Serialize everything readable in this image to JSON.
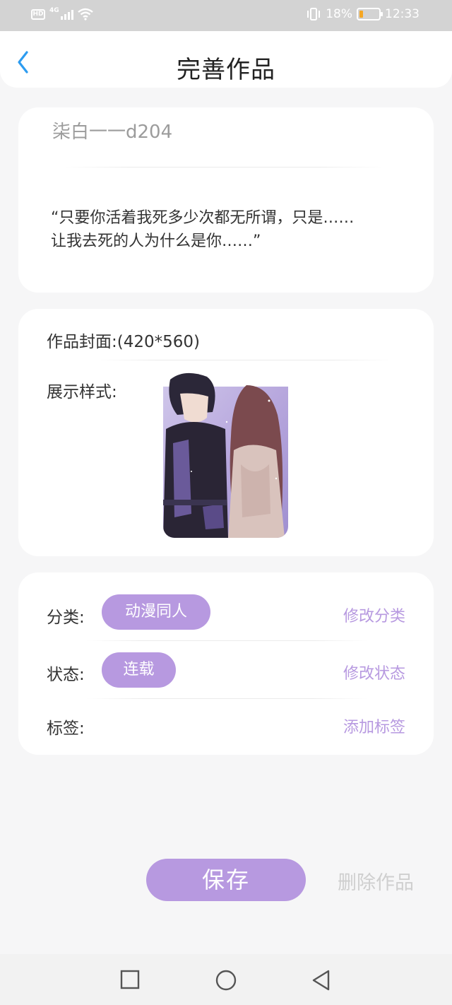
{
  "status_bar": {
    "hd": "HD",
    "network": "4G",
    "battery_percent": "18%",
    "battery_level": 0.18,
    "time": "12:33",
    "battery_color": "#f5a623"
  },
  "header": {
    "title": "完善作品",
    "back_icon": "chevron-left-icon"
  },
  "work": {
    "title": "柒白一一d204",
    "summary_line1": "“只要你活着我死多少次都无所谓，只是……",
    "summary_line2": "让我去死的人为什么是你……”"
  },
  "cover": {
    "label": "作品封面:",
    "size": "(420*560)",
    "style_label": "展示样式:"
  },
  "meta": {
    "category_label": "分类:",
    "category_value": "动漫同人",
    "category_action": "修改分类",
    "status_label": "状态:",
    "status_value": "连载",
    "status_action": "修改状态",
    "tags_label": "标签:",
    "tags_action": "添加标签"
  },
  "footer": {
    "save_label": "保存",
    "delete_label": "删除作品"
  },
  "colors": {
    "accent": "#b799e0",
    "back_arrow": "#2d9cf0",
    "background": "#f6f6f7"
  }
}
